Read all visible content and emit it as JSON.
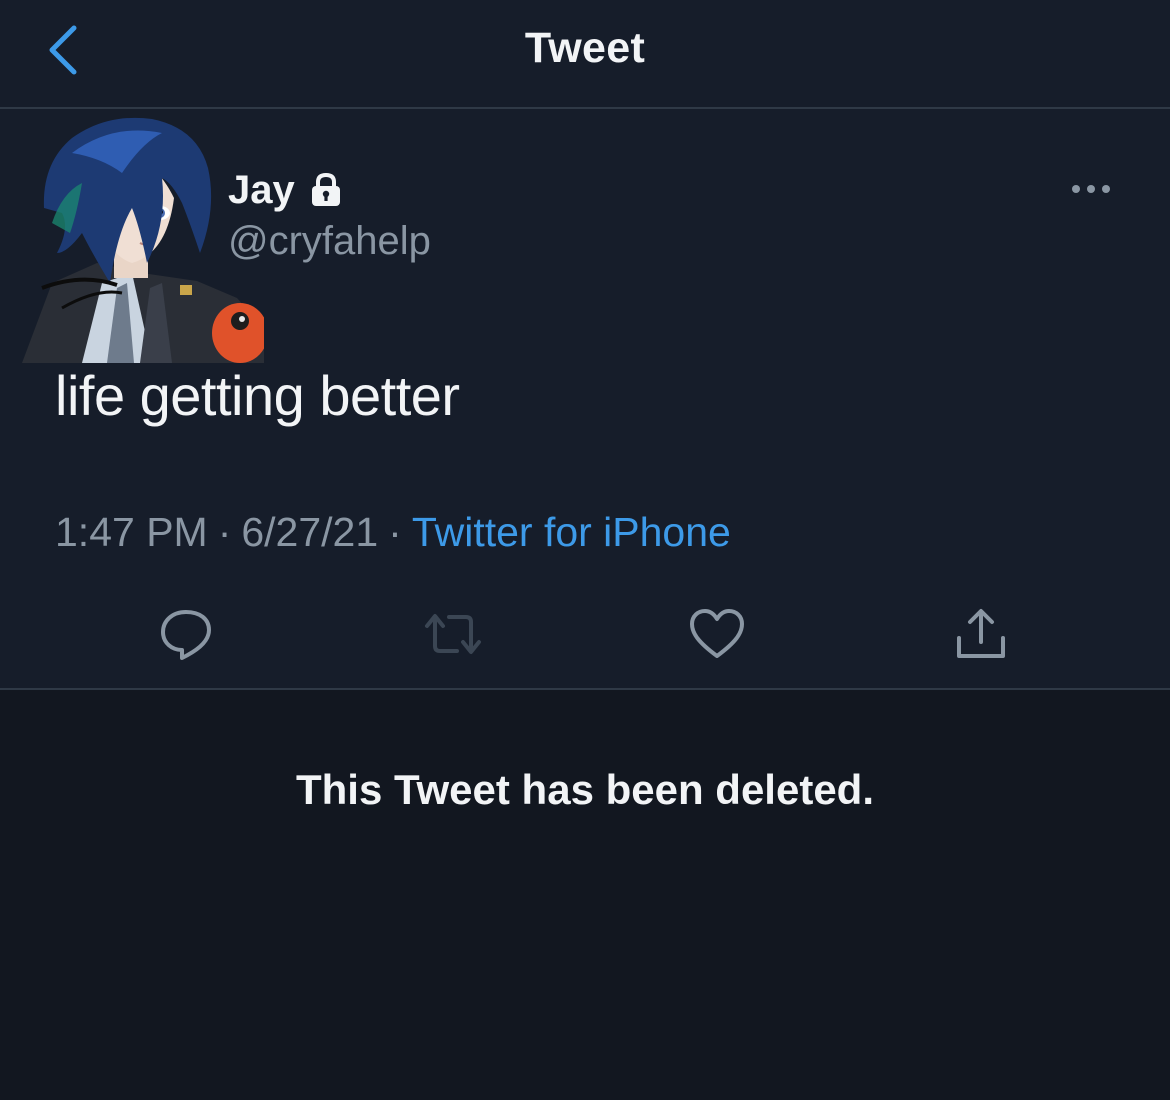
{
  "header": {
    "title": "Tweet",
    "back_icon": "chevron-left-icon",
    "accent_color": "#3d9ae8"
  },
  "tweet": {
    "author": {
      "display_name": "Jay",
      "handle": "@cryfahelp",
      "protected_icon": "lock-icon",
      "avatar": "anime-character-avatar"
    },
    "text": "life getting better",
    "time": "1:47 PM",
    "date": "6/27/21",
    "separator": "·",
    "source": "Twitter for iPhone",
    "more_icon": "more-options-icon",
    "actions": [
      {
        "name": "reply",
        "icon": "comment-icon"
      },
      {
        "name": "retweet",
        "icon": "retweet-icon"
      },
      {
        "name": "like",
        "icon": "heart-icon"
      },
      {
        "name": "share",
        "icon": "share-icon"
      }
    ]
  },
  "notice": {
    "deleted_text": "This Tweet has been deleted."
  },
  "colors": {
    "background": "#161d2a",
    "secondary_text": "#8a96a3",
    "link": "#3d9ae8",
    "divider": "#2f3946"
  }
}
